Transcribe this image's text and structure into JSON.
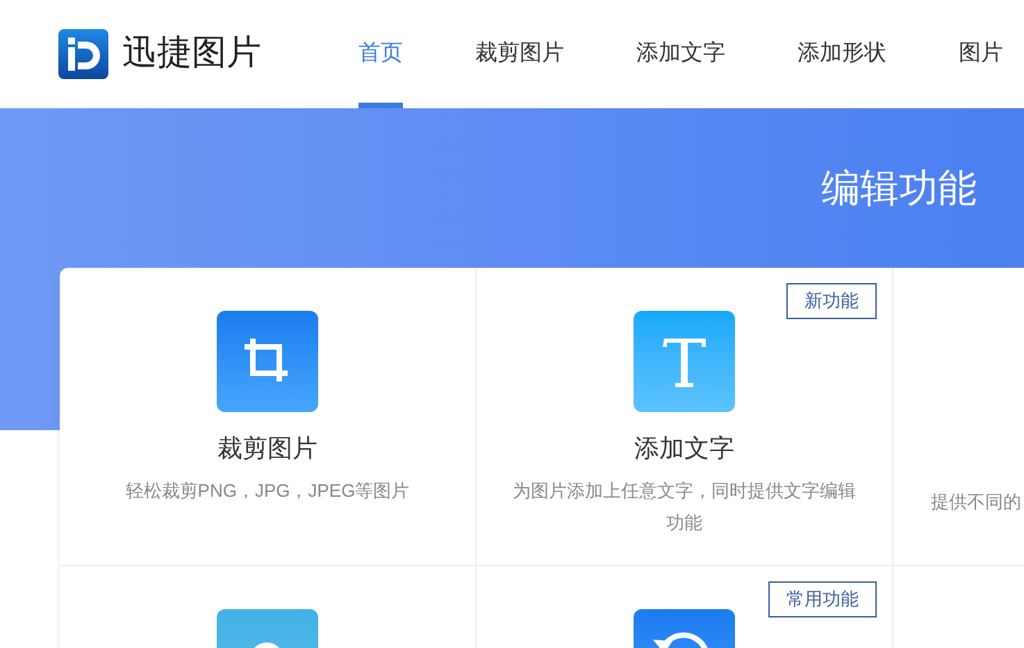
{
  "header": {
    "brand": "迅捷图片",
    "nav": [
      {
        "label": "首页",
        "selected": true
      },
      {
        "label": "裁剪图片",
        "selected": false
      },
      {
        "label": "添加文字",
        "selected": false
      },
      {
        "label": "添加形状",
        "selected": false
      },
      {
        "label": "图片",
        "selected": false
      }
    ]
  },
  "banner": {
    "title": "编辑功能"
  },
  "features": [
    {
      "kind": "crop",
      "title": "裁剪图片",
      "description": "轻松裁剪PNG，JPG，JPEG等图片"
    },
    {
      "kind": "text",
      "title": "添加文字",
      "description": "为图片添加上任意文字，同时提供文字编辑功能",
      "badge": "新功能"
    },
    {
      "kind": "partial",
      "description": "提供不同的"
    },
    {
      "kind": "magnifier"
    },
    {
      "kind": "rotate",
      "badge": "常用功能"
    }
  ]
}
